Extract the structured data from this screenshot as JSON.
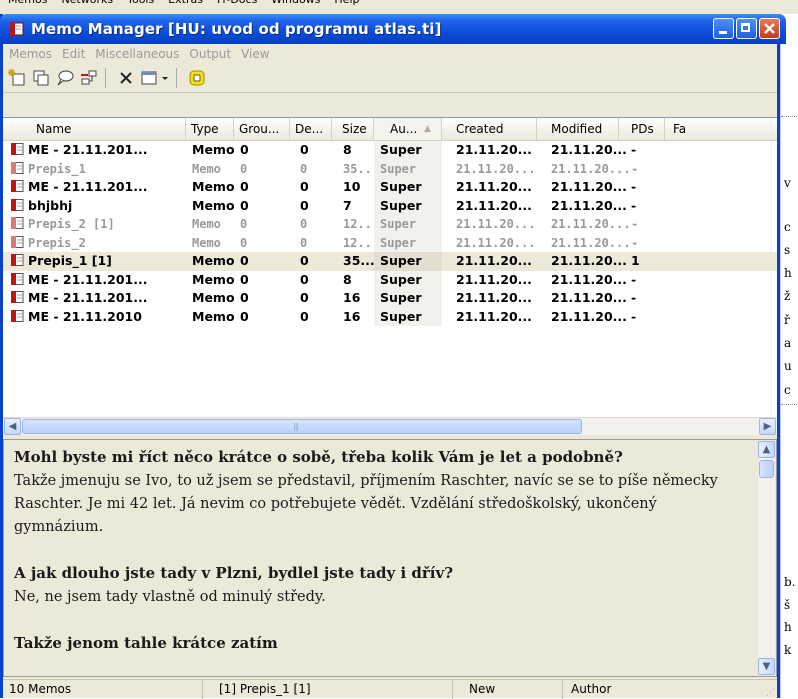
{
  "background": {
    "menu_items": [
      "Memos",
      "Networks",
      "Tools",
      "Extras",
      "Fr-Docs",
      "Windows",
      "Help"
    ],
    "right_fragments": [
      "v",
      "c",
      "s",
      "h",
      "ž",
      "ř",
      "a",
      "u",
      "c",
      "b.",
      "š",
      "h",
      "k"
    ]
  },
  "window": {
    "title": "Memo Manager [HU: uvod od programu atlas.ti]",
    "menu": [
      "Memos",
      "Edit",
      "Miscellaneous",
      "Output",
      "View"
    ]
  },
  "columns": [
    "Name",
    "Type",
    "Grou...",
    "De...",
    "Size",
    "Au...",
    "Created",
    "Modified",
    "PDs",
    "Fa"
  ],
  "rows": [
    {
      "name": "ME - 21.11.201...",
      "type": "Memo",
      "groups": "0",
      "density": "0",
      "size": "8",
      "author": "Super",
      "created": "21.11.20...",
      "modified": "21.11.20...",
      "pds": "-",
      "gray": false,
      "selected": false
    },
    {
      "name": "Prepis_1",
      "type": "Memo",
      "groups": "0",
      "density": "0",
      "size": "35...",
      "author": "Super",
      "created": "21.11.20...",
      "modified": "21.11.20...",
      "pds": "-",
      "gray": true,
      "selected": false
    },
    {
      "name": "ME - 21.11.201...",
      "type": "Memo",
      "groups": "0",
      "density": "0",
      "size": "10",
      "author": "Super",
      "created": "21.11.20...",
      "modified": "21.11.20...",
      "pds": "-",
      "gray": false,
      "selected": false
    },
    {
      "name": "bhjbhj",
      "type": "Memo",
      "groups": "0",
      "density": "0",
      "size": "7",
      "author": "Super",
      "created": "21.11.20...",
      "modified": "21.11.20...",
      "pds": "-",
      "gray": false,
      "selected": false
    },
    {
      "name": "Prepis_2 [1]",
      "type": "Memo",
      "groups": "0",
      "density": "0",
      "size": "12...",
      "author": "Super",
      "created": "21.11.20...",
      "modified": "21.11.20...",
      "pds": "-",
      "gray": true,
      "selected": false
    },
    {
      "name": "Prepis_2",
      "type": "Memo",
      "groups": "0",
      "density": "0",
      "size": "12...",
      "author": "Super",
      "created": "21.11.20...",
      "modified": "21.11.20...",
      "pds": "-",
      "gray": true,
      "selected": false
    },
    {
      "name": "Prepis_1 [1]",
      "type": "Memo",
      "groups": "0",
      "density": "0",
      "size": "35...",
      "author": "Super",
      "created": "21.11.20...",
      "modified": "21.11.20...",
      "pds": "1",
      "gray": false,
      "selected": true
    },
    {
      "name": "ME - 21.11.201...",
      "type": "Memo",
      "groups": "0",
      "density": "0",
      "size": "8",
      "author": "Super",
      "created": "21.11.20...",
      "modified": "21.11.20...",
      "pds": "-",
      "gray": false,
      "selected": false
    },
    {
      "name": "ME - 21.11.201...",
      "type": "Memo",
      "groups": "0",
      "density": "0",
      "size": "16",
      "author": "Super",
      "created": "21.11.20...",
      "modified": "21.11.20...",
      "pds": "-",
      "gray": false,
      "selected": false
    },
    {
      "name": "ME - 21.11.2010",
      "type": "Memo",
      "groups": "0",
      "density": "0",
      "size": "16",
      "author": "Super",
      "created": "21.11.20...",
      "modified": "21.11.20...",
      "pds": "-",
      "gray": false,
      "selected": false
    }
  ],
  "memo": {
    "q1": "Mohl byste mi říct něco krátce o sobě, třeba kolik Vám je let a podobně?",
    "a1": "Takže jmenuju se Ivo, to už jsem se představil, příjmením Raschter, navíc se se to píše německy Raschter. Je mi 42 let. Já nevim co potřebujete vědět. Vzdělání středoškolský, ukončený gymnázium.",
    "q2": "A jak dlouho jste tady v Plzni, bydlel jste tady i dřív?",
    "a2": "Ne, ne jsem tady vlastně od minulý středy.",
    "q3": "Takže jenom tahle krátce zatím"
  },
  "status": {
    "count": "10 Memos",
    "current": "[1] Prepis_1 [1]",
    "state": "New",
    "author": "Author"
  },
  "colors": {
    "title_blue": "#0a4ad6",
    "memo_icon_red": "#c0121a",
    "selected_row": "#ece9d8"
  }
}
